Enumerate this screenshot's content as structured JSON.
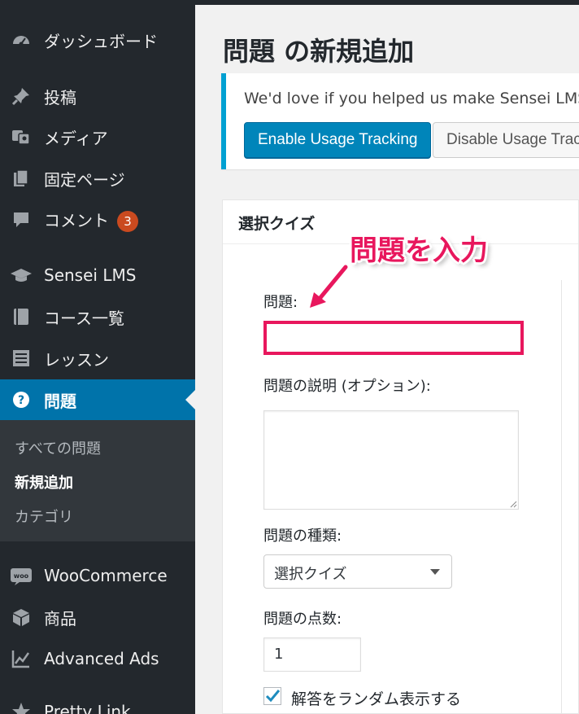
{
  "sidebar": {
    "items": [
      {
        "label": "ダッシュボード",
        "icon": "dashboard-icon"
      },
      {
        "label": "投稿",
        "icon": "pin-icon"
      },
      {
        "label": "メディア",
        "icon": "media-icon"
      },
      {
        "label": "固定ページ",
        "icon": "pages-icon"
      },
      {
        "label": "コメント",
        "icon": "comment-icon",
        "badge": "3"
      },
      {
        "label": "Sensei LMS",
        "icon": "graduation-cap-icon"
      },
      {
        "label": "コース一覧",
        "icon": "book-icon"
      },
      {
        "label": "レッスン",
        "icon": "list-icon"
      },
      {
        "label": "問題",
        "icon": "question-icon",
        "active": true
      },
      {
        "label": "WooCommerce",
        "icon": "woocommerce-icon"
      },
      {
        "label": "商品",
        "icon": "box-icon"
      },
      {
        "label": "Advanced Ads",
        "icon": "chart-icon"
      },
      {
        "label": "Pretty Link",
        "icon": "star-icon"
      }
    ],
    "submenu": [
      {
        "label": "すべての問題"
      },
      {
        "label": "新規追加",
        "current": true
      },
      {
        "label": "カテゴリ"
      }
    ]
  },
  "page": {
    "title": "問題 の新規追加"
  },
  "notice": {
    "text": "We'd love if you helped us make Sensei LMS better",
    "enable_label": "Enable Usage Tracking",
    "disable_label": "Disable Usage Tracking"
  },
  "metabox": {
    "title": "選択クイズ",
    "question_label": "問題:",
    "question_value": "",
    "description_label": "問題の説明 (オプション):",
    "type_label": "問題の種類:",
    "type_value": "選択クイズ",
    "points_label": "問題の点数:",
    "points_value": "1",
    "random_label": "解答をランダム表示する",
    "random_checked": true
  },
  "annotation": {
    "text": "問題を入力"
  },
  "colors": {
    "sidebar_bg": "#23282d",
    "active_blue": "#0073aa",
    "highlight_pink": "#e8175d",
    "notice_border": "#00a0d2",
    "badge": "#ca4a1f"
  }
}
